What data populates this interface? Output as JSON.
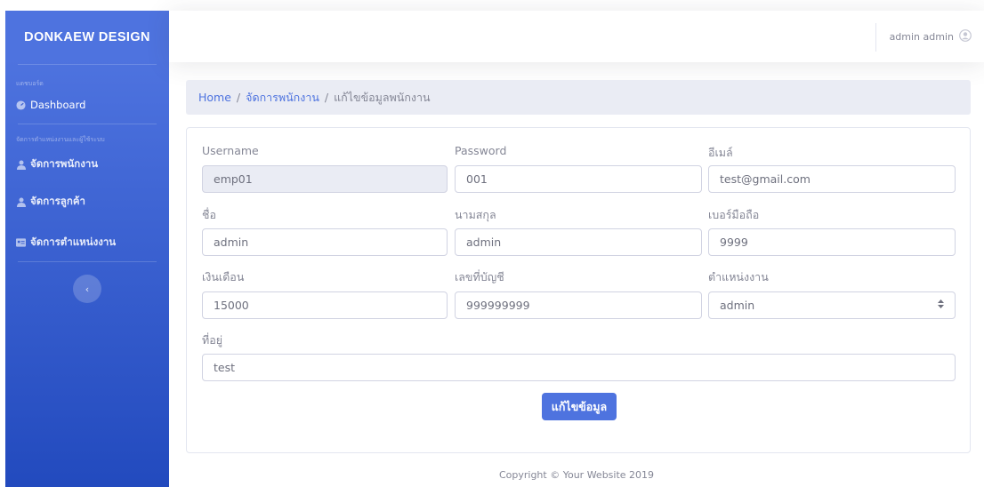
{
  "sidebar": {
    "brand": "DONKAEW DESIGN",
    "heading_dashboard": "แดชบอร์ด",
    "dashboard_label": "Dashboard",
    "heading_manage": "จัดการตำแหน่งงานและผู้ใช้ระบบ",
    "items": [
      {
        "label": "จัดการพนักงาน",
        "icon": "user-icon"
      },
      {
        "label": "จัดการลูกค้า",
        "icon": "user-icon"
      },
      {
        "label": "จัดการตำแหน่งงาน",
        "icon": "id-card-icon"
      }
    ],
    "toggle_icon": "‹"
  },
  "topbar": {
    "user_name": "admin admin",
    "user_icon": "user-circle-icon"
  },
  "breadcrumb": {
    "home": "Home",
    "sep1": "/",
    "section": "จัดการพนักงาน",
    "sep2": "/",
    "current": "แก้ไขข้อมูลพนักงาน"
  },
  "form": {
    "username_label": "Username",
    "username_value": "emp01",
    "password_label": "Password",
    "password_value": "001",
    "email_label": "อีเมล์",
    "email_value": "test@gmail.com",
    "firstname_label": "ชื่อ",
    "firstname_value": "admin",
    "lastname_label": "นามสกุล",
    "lastname_value": "admin",
    "phone_label": "เบอร์มือถือ",
    "phone_value": "9999",
    "salary_label": "เงินเดือน",
    "salary_value": "15000",
    "account_label": "เลขที่บัญชี",
    "account_value": "999999999",
    "position_label": "ตำแหน่งงาน",
    "position_value": "admin",
    "address_label": "ที่อยู่",
    "address_value": "test",
    "submit_label": "แก้ไขข้อมูล"
  },
  "footer": {
    "copyright": "Copyright © Your Website 2019"
  },
  "colors": {
    "primary": "#4e73df",
    "sidebar_dark": "#224abe",
    "breadcrumb_bg": "#eaecf4"
  }
}
